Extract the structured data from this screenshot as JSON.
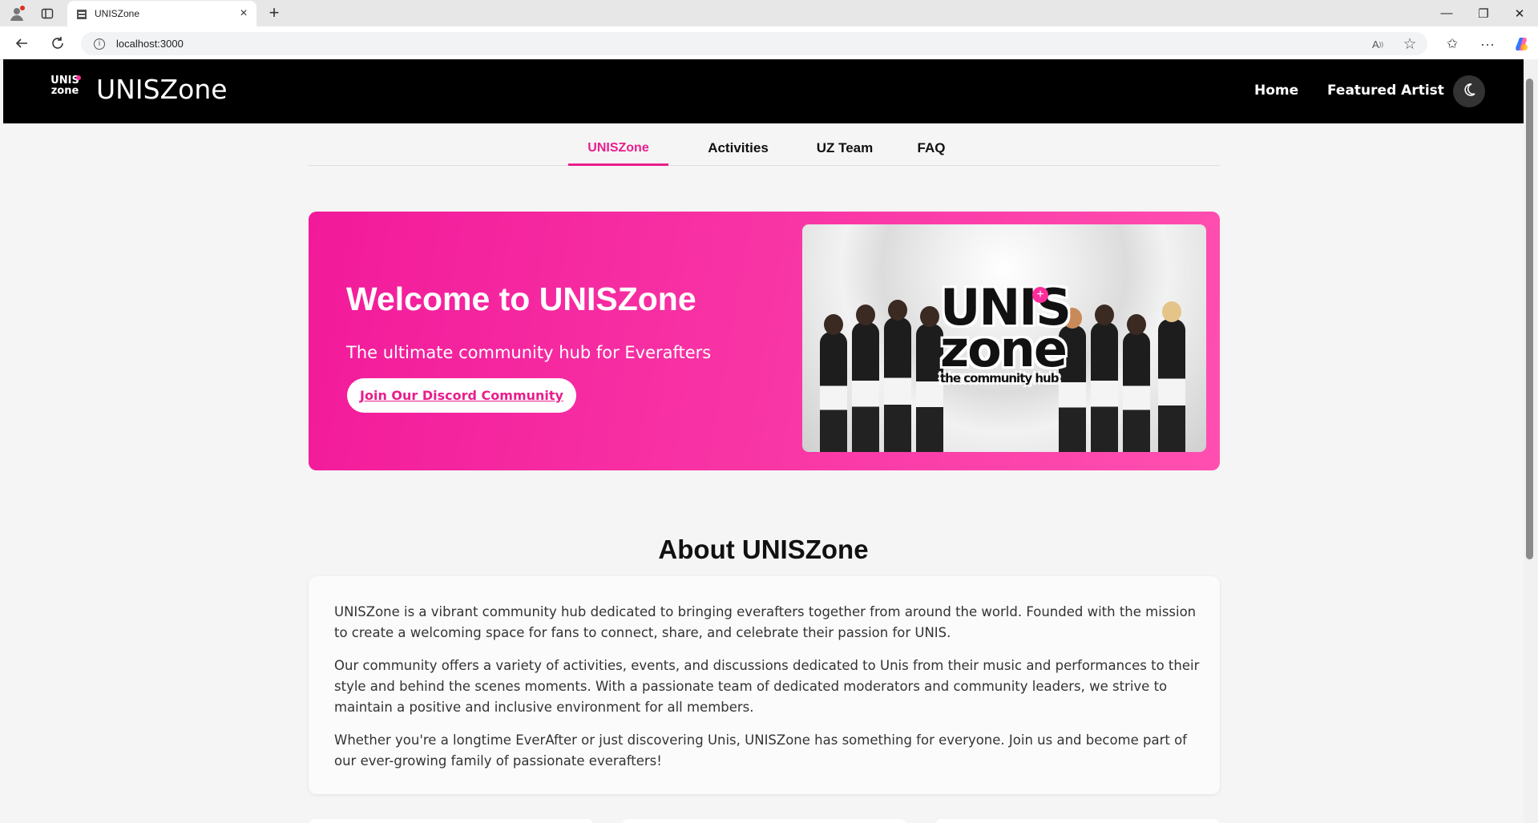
{
  "browser": {
    "tab_title": "UNISZone",
    "url": "localhost:3000",
    "new_tab": "+",
    "close_tab": "×",
    "minimize": "—",
    "restore": "❐",
    "close_window": "✕"
  },
  "header": {
    "logo_text_line1": "UNIS",
    "logo_text_line2": "zone",
    "site_title": "UNISZone",
    "nav": {
      "home": "Home",
      "featured_artist": "Featured Artist"
    },
    "theme_icon": "moon-icon"
  },
  "tabs": [
    "UNISZone",
    "Activities",
    "UZ Team",
    "FAQ"
  ],
  "active_tab": "UNISZone",
  "hero": {
    "title": "Welcome to UNISZone",
    "subtitle": "The ultimate community hub for Everafters",
    "button": "Join Our Discord Community",
    "image_logo_line1": "UNIS",
    "image_logo_line2": "zone",
    "image_tagline": "the community hub"
  },
  "about": {
    "title": "About UNISZone",
    "paragraphs": [
      "UNISZone is a vibrant community hub dedicated to bringing everafters together from around the world. Founded with the mission to create a welcoming space for fans to connect, share, and celebrate their passion for UNIS.",
      "Our community offers a variety of activities, events, and discussions dedicated to Unis from their music and performances to their style and behind the scenes moments. With a passionate team of dedicated moderators and community leaders, we strive to maintain a positive and inclusive environment for all members.",
      "Whether you're a longtime EverAfter or just discovering Unis, UNISZone has something for everyone. Join us and become part of our ever-growing family of passionate everafters!"
    ]
  },
  "colors": {
    "accent": "#e91e8c",
    "header_bg": "#000000",
    "page_bg": "#f5f5f5"
  }
}
